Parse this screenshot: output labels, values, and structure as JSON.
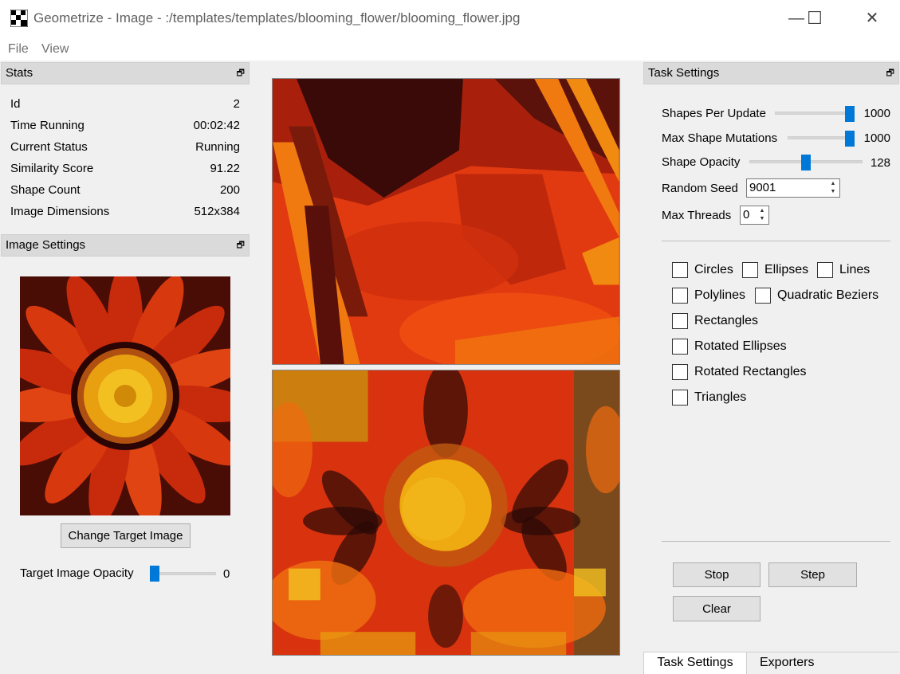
{
  "window": {
    "title": "Geometrize - Image - :/templates/templates/blooming_flower/blooming_flower.jpg",
    "minimize_glyph": "—",
    "maximize_glyph": "☐",
    "close_glyph": "✕"
  },
  "menu": {
    "file": "File",
    "view": "View"
  },
  "stats": {
    "title": "Stats",
    "rows": [
      {
        "label": "Id",
        "value": "2"
      },
      {
        "label": "Time Running",
        "value": "00:02:42"
      },
      {
        "label": "Current Status",
        "value": "Running"
      },
      {
        "label": "Similarity Score",
        "value": "91.22"
      },
      {
        "label": "Shape Count",
        "value": "200"
      },
      {
        "label": "Image Dimensions",
        "value": "512x384"
      }
    ]
  },
  "image_settings": {
    "title": "Image Settings",
    "change_target_label": "Change Target Image",
    "target_opacity_label": "Target Image Opacity",
    "target_opacity_value": "0",
    "target_opacity_fraction": 0
  },
  "task_settings": {
    "title": "Task Settings",
    "shapes_per_update_label": "Shapes Per Update",
    "shapes_per_update_value": "1000",
    "shapes_per_update_fraction": 1.0,
    "max_mutations_label": "Max Shape Mutations",
    "max_mutations_value": "1000",
    "max_mutations_fraction": 1.0,
    "shape_opacity_label": "Shape Opacity",
    "shape_opacity_value": "128",
    "shape_opacity_fraction": 0.5,
    "random_seed_label": "Random Seed",
    "random_seed_value": "9001",
    "max_threads_label": "Max Threads",
    "max_threads_value": "0",
    "shape_types": {
      "circles": "Circles",
      "ellipses": "Ellipses",
      "lines": "Lines",
      "polylines": "Polylines",
      "quadratic_beziers": "Quadratic Beziers",
      "rectangles": "Rectangles",
      "rotated_ellipses": "Rotated Ellipses",
      "rotated_rectangles": "Rotated Rectangles",
      "triangles": "Triangles"
    },
    "stop_label": "Stop",
    "step_label": "Step",
    "clear_label": "Clear"
  },
  "tabs": {
    "task_settings": "Task Settings",
    "exporters": "Exporters"
  },
  "colors": {
    "accent": "#0078d7",
    "flower_red": "#d8320f",
    "flower_yellow": "#f0b010",
    "flower_dark": "#3a0a08"
  }
}
